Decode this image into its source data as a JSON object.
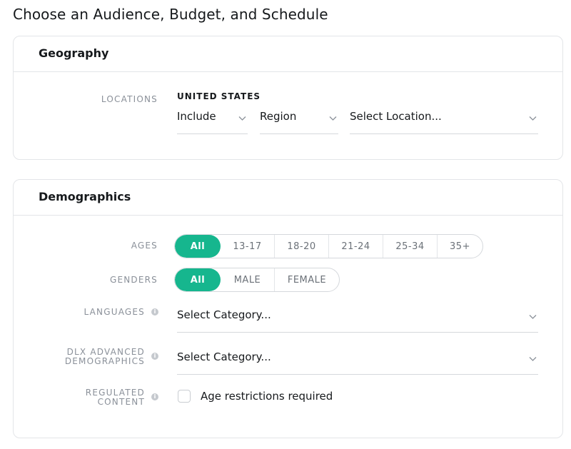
{
  "page": {
    "title": "Choose an Audience, Budget, and Schedule"
  },
  "geography": {
    "title": "Geography",
    "locations_label": "LOCATIONS",
    "country": "UNITED STATES",
    "include_select": "Include",
    "type_select": "Region",
    "location_select": "Select Location..."
  },
  "demographics": {
    "title": "Demographics",
    "ages_label": "AGES",
    "ages": [
      "All",
      "13-17",
      "18-20",
      "21-24",
      "25-34",
      "35+"
    ],
    "ages_selected": "All",
    "genders_label": "GENDERS",
    "genders": [
      "All",
      "MALE",
      "FEMALE"
    ],
    "genders_selected": "All",
    "languages_label": "LANGUAGES",
    "languages_select": "Select Category...",
    "dlx_label": "DLX ADVANCED DEMOGRAPHICS",
    "dlx_select": "Select Category...",
    "regulated_label": "REGULATED CONTENT",
    "regulated_checkbox_label": "Age restrictions required",
    "regulated_checked": false
  },
  "colors": {
    "accent": "#16b68e",
    "border": "#e3e5e8",
    "label_gray": "#8a9099"
  },
  "icons": {
    "dropdown": "chevron-down-icon",
    "info": "info-icon"
  }
}
